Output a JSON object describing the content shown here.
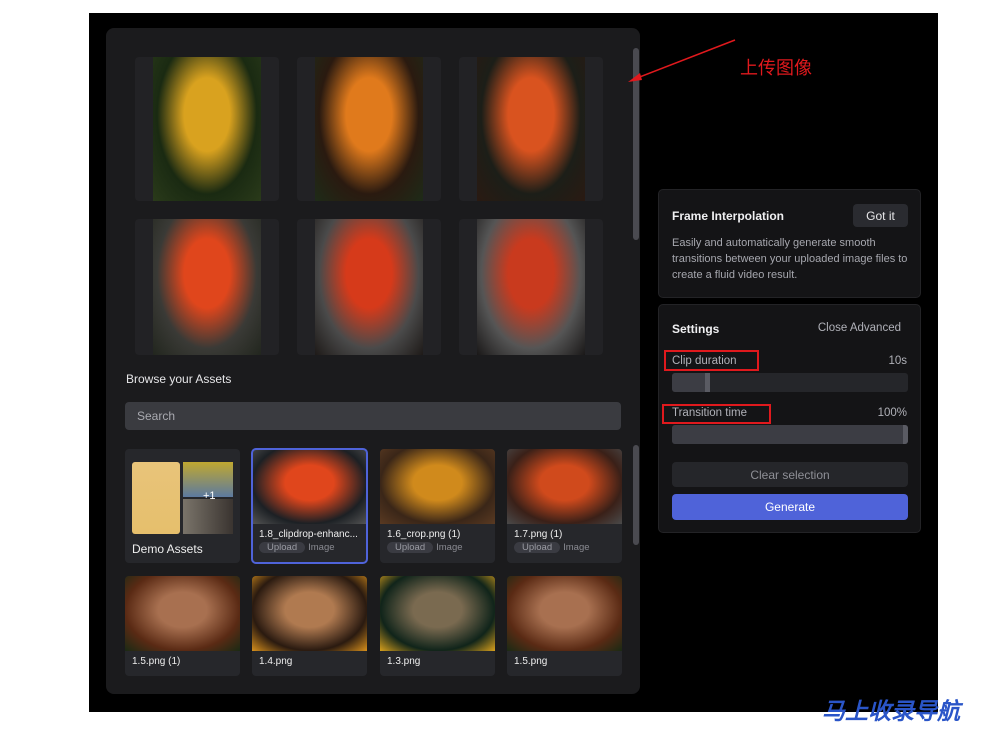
{
  "annotation": {
    "label": "上传图像",
    "color": "#e0191d"
  },
  "watermark": "马上收录导航",
  "gallery": {
    "images": [
      {
        "colors": [
          "#2a3a1a",
          "#d9a21f",
          "#1a2a12"
        ]
      },
      {
        "colors": [
          "#1e2b18",
          "#e07a1c",
          "#2a1a10"
        ]
      },
      {
        "colors": [
          "#2a1a12",
          "#d9531f",
          "#1c1e18"
        ]
      },
      {
        "colors": [
          "#22261e",
          "#e0461c",
          "#3a3a36"
        ]
      },
      {
        "colors": [
          "#1e1a18",
          "#d63a1a",
          "#4a4a4a"
        ]
      },
      {
        "colors": [
          "#1a1818",
          "#c93a1e",
          "#555"
        ]
      }
    ]
  },
  "assets": {
    "heading": "Browse your Assets",
    "search_placeholder": "Search",
    "folder": {
      "name": "Demo Assets",
      "more": "+1"
    },
    "items": [
      {
        "name": "1.8_clipdrop-enhanc...",
        "tag": "Upload",
        "type": "Image",
        "selected": true,
        "colors": [
          "#1c2024",
          "#e0461c",
          "#555"
        ]
      },
      {
        "name": "1.6_crop.png (1)",
        "tag": "Upload",
        "type": "Image",
        "colors": [
          "#3a2618",
          "#d08a1c",
          "#5a3a22"
        ]
      },
      {
        "name": "1.7.png (1)",
        "tag": "Upload",
        "type": "Image",
        "colors": [
          "#3a2018",
          "#d04a1c",
          "#4a4a4a"
        ]
      },
      {
        "name": "1.5.png (1)",
        "colors": [
          "#5a2a14",
          "#a87050",
          "#1a2a14"
        ]
      },
      {
        "name": "1.4.png",
        "colors": [
          "#2a1a10",
          "#b07a50",
          "#d8901c"
        ]
      },
      {
        "name": "1.3.png",
        "colors": [
          "#10241a",
          "#7a6a50",
          "#d8a01c"
        ]
      },
      {
        "name": "1.5.png",
        "colors": [
          "#5a2a14",
          "#a87050",
          "#1a2a14"
        ]
      }
    ]
  },
  "info": {
    "title": "Frame Interpolation",
    "got_it": "Got it",
    "description": "Easily and automatically generate smooth transitions between your uploaded image files to create a fluid video result."
  },
  "settings": {
    "title": "Settings",
    "toggle": "Close Advanced",
    "clip_duration": {
      "label": "Clip duration",
      "value": "10s",
      "fraction": 0.16
    },
    "transition_time": {
      "label": "Transition time",
      "value": "100%",
      "fraction": 1.0
    },
    "clear": "Clear selection",
    "generate": "Generate",
    "accent": "#4f63d9"
  }
}
